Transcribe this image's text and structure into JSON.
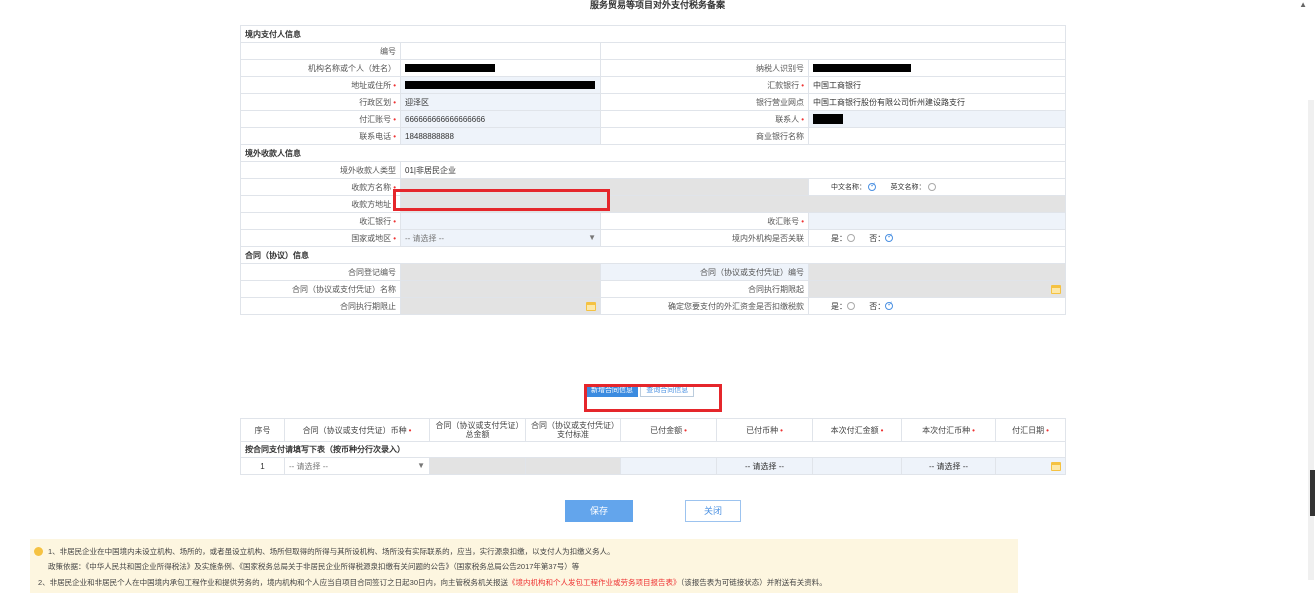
{
  "page_title": "服务贸易等项目对外支付税务备案",
  "sections": {
    "domestic_payer": "境内支付人信息",
    "overseas_payee": "境外收款人信息",
    "contract": "合同（协议）信息",
    "payment": "按合同支付请填写下表（按币种分行次录入）"
  },
  "domestic": {
    "number_label": "编号",
    "org_name_label": "机构名称或个人（姓名）",
    "taxpayer_id_label": "纳税人识别号",
    "address_label": "地址或住所",
    "remit_bank_label": "汇款银行",
    "remit_bank_value": "中国工商银行",
    "district_label": "行政区划",
    "district_value": "迎泽区",
    "branch_label": "银行营业网点",
    "branch_value": "中国工商银行股份有限公司忻州建设路支行",
    "account_label": "付汇账号",
    "account_value": "666666666666666666",
    "contact_label": "联系人",
    "phone_label": "联系电话",
    "phone_value": "18488888888",
    "commercial_bank_label": "商业银行名称"
  },
  "overseas": {
    "payee_type_label": "境外收款人类型",
    "payee_type_value": "01|非居民企业",
    "payee_name_label": "收款方名称",
    "chinese_name_label": "中文名称：",
    "english_name_label": "英文名称：",
    "payee_address_label": "收款方地址",
    "receive_bank_label": "收汇银行",
    "receive_account_label": "收汇账号",
    "country_label": "国家或地区",
    "country_placeholder": "-- 请选择 --",
    "related_label": "境内外机构是否关联",
    "yes_label": "是：",
    "no_label": "否："
  },
  "contract": {
    "reg_no_label": "合同登记编号",
    "contract_no_label": "合同（协议或支付凭证）编号",
    "contract_name_label": "合同（协议或支付凭证）名称",
    "start_label": "合同执行期限起",
    "end_label": "合同执行期限止",
    "confirm_label": "确定您要支付的外汇资金是否扣缴税款",
    "yes_label": "是：",
    "no_label": "否："
  },
  "actions": {
    "add_contract": "新增合同信息",
    "query_contract": "查询合同信息",
    "save": "保存",
    "close": "关闭"
  },
  "payment_table": {
    "headers": [
      "序号",
      "合同（协议或支付凭证）币种",
      "合同（协议或支付凭证）总金额",
      "合同（协议或支付凭证）支付标准",
      "已付金额",
      "已付币种",
      "本次付汇金额",
      "本次付汇币种",
      "付汇日期"
    ],
    "row_no": "1",
    "select_placeholder": "-- 请选择 --"
  },
  "notice": {
    "line1": "1、非居民企业在中国境内未设立机构、场所的，或者虽设立机构、场所但取得的所得与其所设机构、场所没有实际联系的，应当，实行源泉扣缴，以支付人为扣缴义务人。",
    "line2": "政策依据：《中华人民共和国企业所得税法》及实施条例、《国家税务总局关于非居民企业所得税源泉扣缴有关问题的公告》（国家税务总局公告2017年第37号）等",
    "line3a": "2、非居民企业和非居民个人在中国境内承包工程作业和提供劳务的，境内机构和个人应当自项目合同签订之日起30日内，向主管税务机关报送",
    "line3b": "《境内机构和个人发包工程作业或劳务项目报告表》",
    "line3c": "（该报告表为可链接状态）并附送有关资料。"
  },
  "colors": {
    "required": "#e33",
    "primary": "#3b8be0",
    "highlight_box": "#e5262b",
    "notice_bg": "#fdf6e0"
  }
}
